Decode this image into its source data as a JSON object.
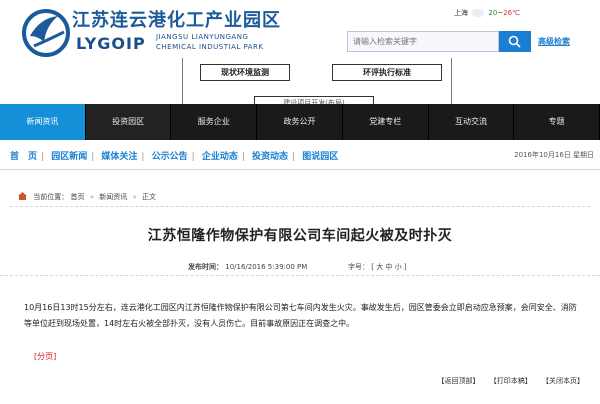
{
  "brand": {
    "title_cn": "江苏连云港化工产业园区",
    "brand_short": "LYGOIP",
    "en_line1": "JIANGSU LIANYUNGANG",
    "en_line2": "CHEMICAL INDUSTIAL PARK"
  },
  "weather": {
    "city": "上海",
    "temp_low": "20",
    "temp_sep": "~",
    "temp_high": "26℃"
  },
  "search": {
    "placeholder": "请输入检索关键字",
    "advanced_label": "高级检索"
  },
  "flow": {
    "box_a": "现状环境监测",
    "box_b": "环评执行标准",
    "box_c": "建设项目开发(布局)"
  },
  "mainnav": [
    "新闻资讯",
    "投资园区",
    "服务企业",
    "政务公开",
    "党建专栏",
    "互动交流",
    "专题"
  ],
  "subnav": {
    "links": [
      "首　页",
      "园区新闻",
      "媒体关注",
      "公示公告",
      "企业动态",
      "投资动态",
      "图说园区"
    ],
    "date": "2016年10月16日 星期日"
  },
  "breadcrumb": {
    "label": "当前位置：",
    "items": [
      "首页",
      "新闻资讯",
      "正文"
    ],
    "arrow": "»"
  },
  "article": {
    "title": "江苏恒隆作物保护有限公司车间起火被及时扑灭",
    "time_label": "发布时间：",
    "time_value": "10/16/2016 5:39:00 PM",
    "size_label": "字号：",
    "size_options": "[ 大 中 小 ]",
    "body": "10月16日13时15分左右，连云港化工园区内江苏恒隆作物保护有限公司第七车间内发生火灾。事故发生后，园区管委会立即启动应急预案，会同安全、消防等单位赶到现场处置，14时左右火被全部扑灭，没有人员伤亡。目前事故原因正在调查之中。",
    "pagebreak": "[分页]"
  },
  "actions": [
    "【返回顶部】",
    "【打印本稿】",
    "【关闭本页】"
  ]
}
